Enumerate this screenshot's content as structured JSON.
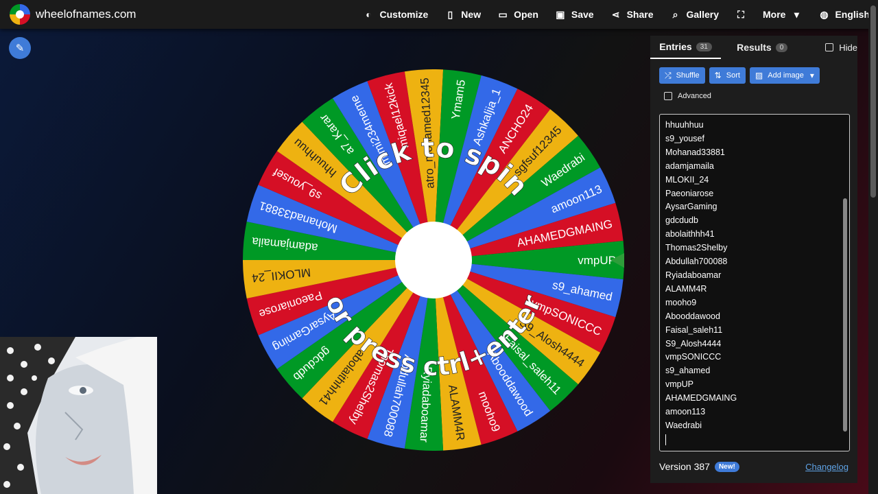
{
  "header": {
    "site_name": "wheelofnames.com",
    "nav": [
      {
        "label": "Customize",
        "icon": "palette-icon",
        "glyph": "◐"
      },
      {
        "label": "New",
        "icon": "file-icon",
        "glyph": "▯"
      },
      {
        "label": "Open",
        "icon": "folder-open-icon",
        "glyph": "▭"
      },
      {
        "label": "Save",
        "icon": "floppy-icon",
        "glyph": "▣"
      },
      {
        "label": "Share",
        "icon": "share-icon",
        "glyph": "⋖"
      },
      {
        "label": "Gallery",
        "icon": "search-icon",
        "glyph": "⌕"
      },
      {
        "label": "",
        "icon": "fullscreen-icon",
        "glyph": "⛶"
      },
      {
        "label": "More",
        "icon": "chevron-down-icon",
        "glyph": "▾"
      },
      {
        "label": "English",
        "icon": "globe-icon",
        "glyph": "◍"
      }
    ]
  },
  "wheel": {
    "center_text_top": "Click to spin",
    "center_text_bottom": "or press ctrl+enter",
    "colors": [
      "#eeb211",
      "#009925",
      "#3369e8",
      "#d50f25"
    ],
    "pointer_color": "#2e9d3a",
    "segments": [
      "vmpUP",
      "s9_ahamed",
      "vmpSONICCC",
      "S9_Alosh4444",
      "Faisal_saleh11",
      "Abooddawood",
      "mooho9",
      "ALAMM4R",
      "Ryiadaboamar",
      "Abdullah700088",
      "Thomas2Shelby",
      "abolaithhh41",
      "gdcdudb",
      "AysarGaming",
      "Paeoniarose",
      "MLOKII_24",
      "adamjamaila",
      "Mohanad33881",
      "s9_yousef",
      "hhuuhhuu",
      "a7_Karar",
      "mimi234meme",
      "miqael12kick",
      "atro_mohamed12345",
      "Ymam5",
      "Ashkaljia_1",
      "ANCHO24",
      "sgfsuf12345",
      "Waedrabi",
      "amoon113",
      "AHAMEDGMAING"
    ]
  },
  "panel": {
    "tab_entries": "Entries",
    "entries_count": "31",
    "tab_results": "Results",
    "results_count": "0",
    "hide_label": "Hide",
    "shuffle_label": "Shuffle",
    "sort_label": "Sort",
    "add_image_label": "Add image",
    "advanced_label": "Advanced",
    "visible_entries": [
      "hhuuhhuu",
      "s9_yousef",
      "Mohanad33881",
      "adamjamaila",
      "MLOKII_24",
      "Paeoniarose",
      "AysarGaming",
      "gdcdudb",
      "abolaithhh41",
      "Thomas2Shelby",
      "Abdullah700088",
      "Ryiadaboamar",
      "ALAMM4R",
      "mooho9",
      "Abooddawood",
      "Faisal_saleh11",
      "S9_Alosh4444",
      "vmpSONICCC",
      "s9_ahamed",
      "vmpUP",
      "AHAMEDGMAING",
      "amoon113",
      "Waedrabi"
    ],
    "version": "Version 387",
    "new_badge": "New!",
    "changelog": "Changelog"
  }
}
